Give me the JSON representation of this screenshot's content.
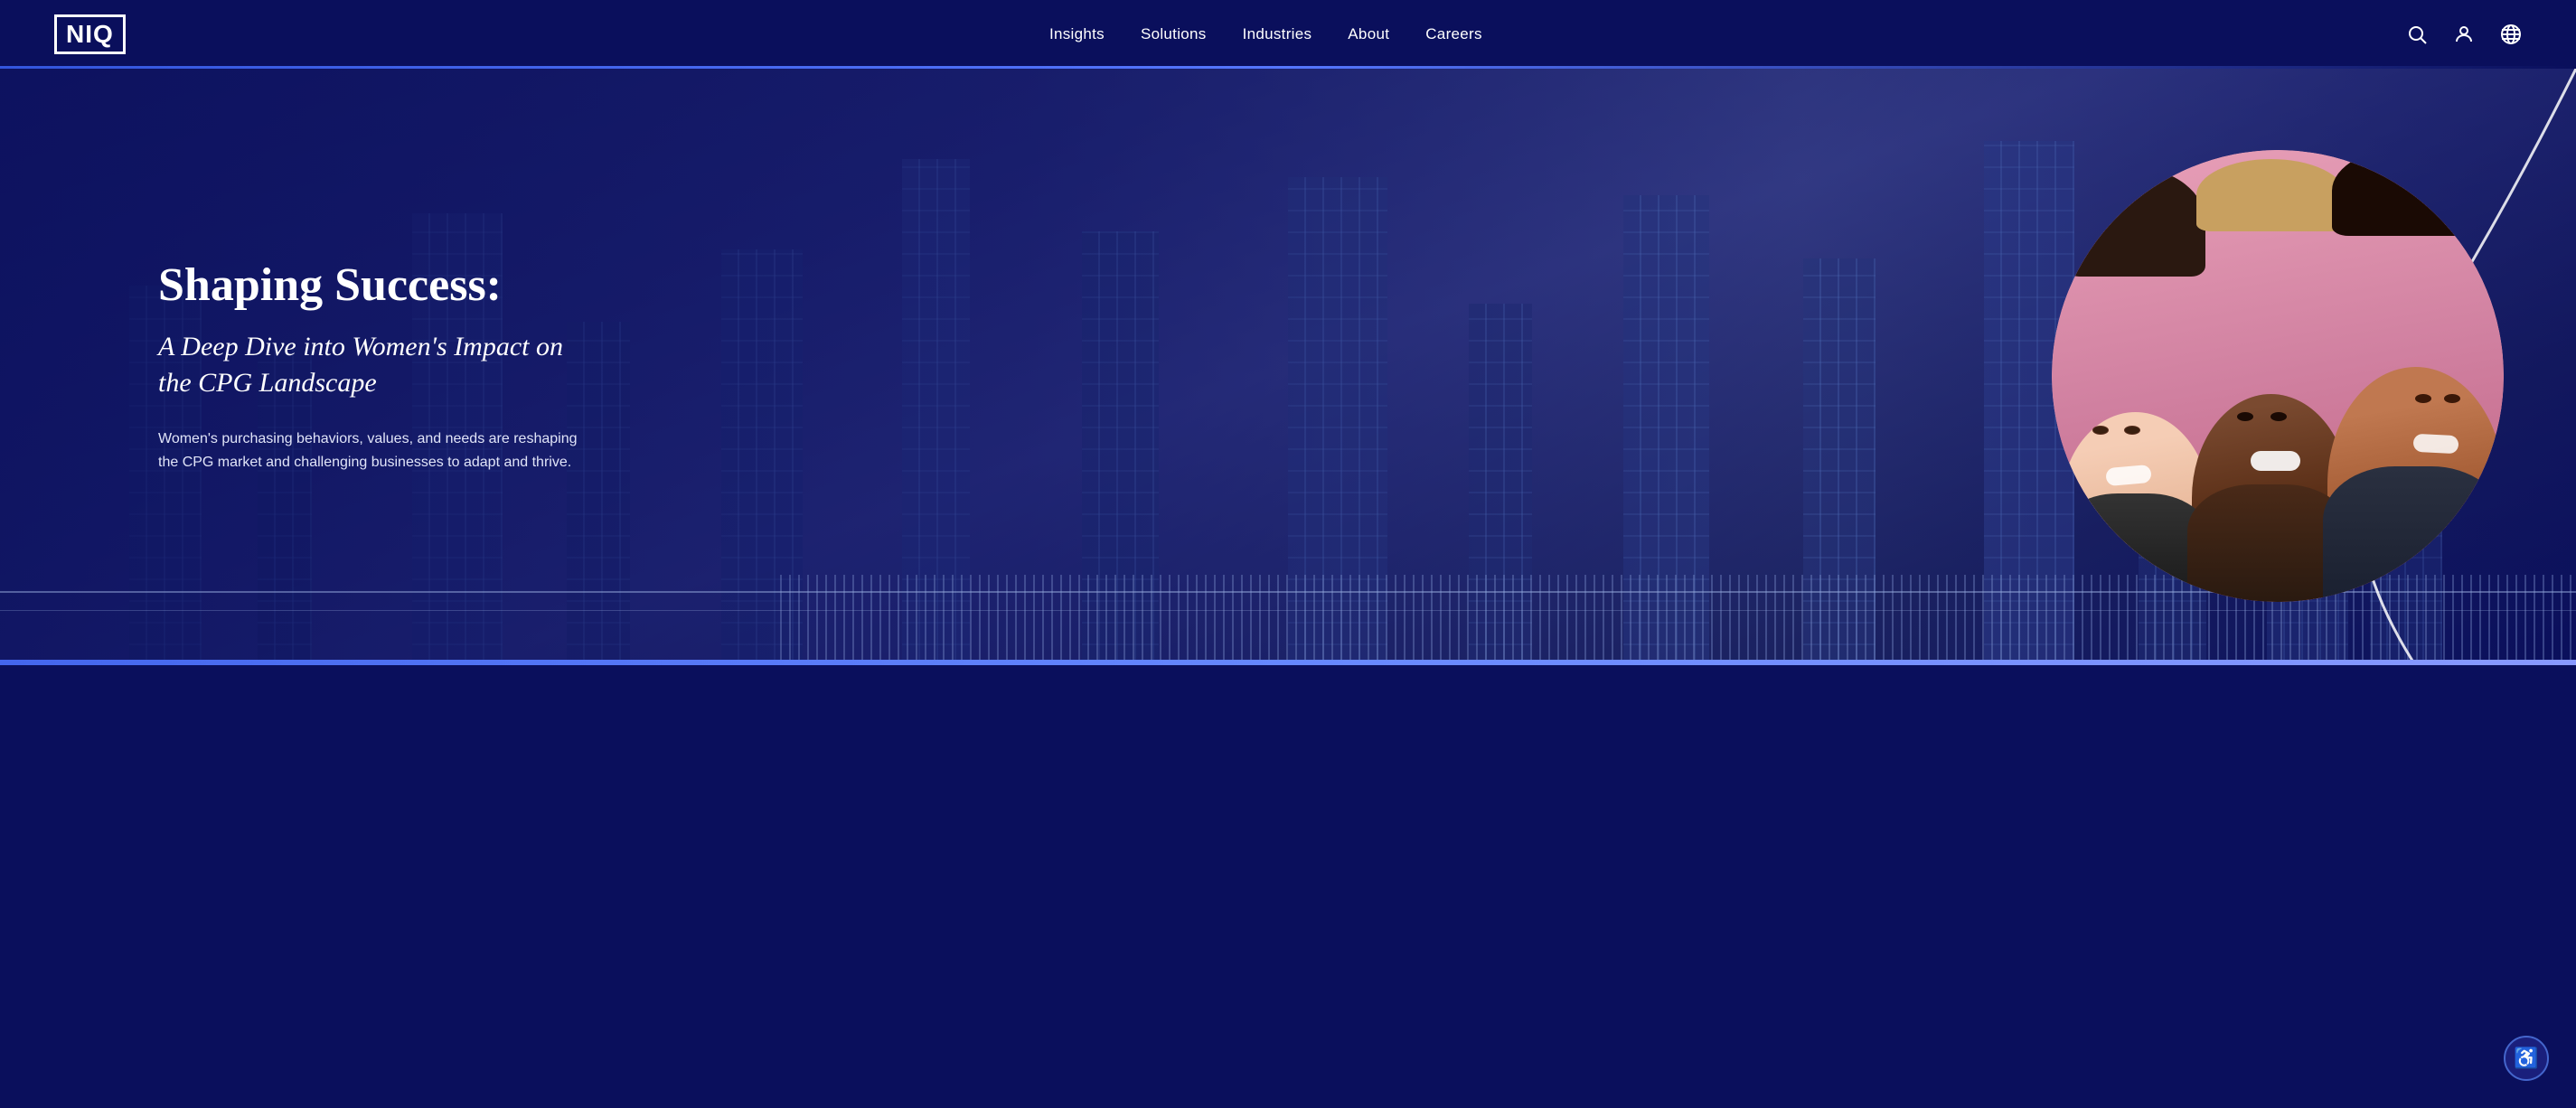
{
  "brand": {
    "logo": "NIQ"
  },
  "nav": {
    "links": [
      {
        "label": "Insights",
        "id": "insights"
      },
      {
        "label": "Solutions",
        "id": "solutions"
      },
      {
        "label": "Industries",
        "id": "industries"
      },
      {
        "label": "About",
        "id": "about"
      },
      {
        "label": "Careers",
        "id": "careers"
      }
    ],
    "icons": [
      {
        "name": "search-icon",
        "label": "Search"
      },
      {
        "name": "user-icon",
        "label": "User Account"
      },
      {
        "name": "globe-icon",
        "label": "Language / Region"
      }
    ]
  },
  "hero": {
    "title": "Shaping Success:",
    "subtitle": "A Deep Dive into Women's Impact on\nthe CPG Landscape",
    "description": "Women's purchasing behaviors, values, and needs are reshaping the CPG market and challenging businesses to adapt and thrive.",
    "accent_color": "#4a6de8"
  },
  "accessibility": {
    "button_label": "♿"
  }
}
